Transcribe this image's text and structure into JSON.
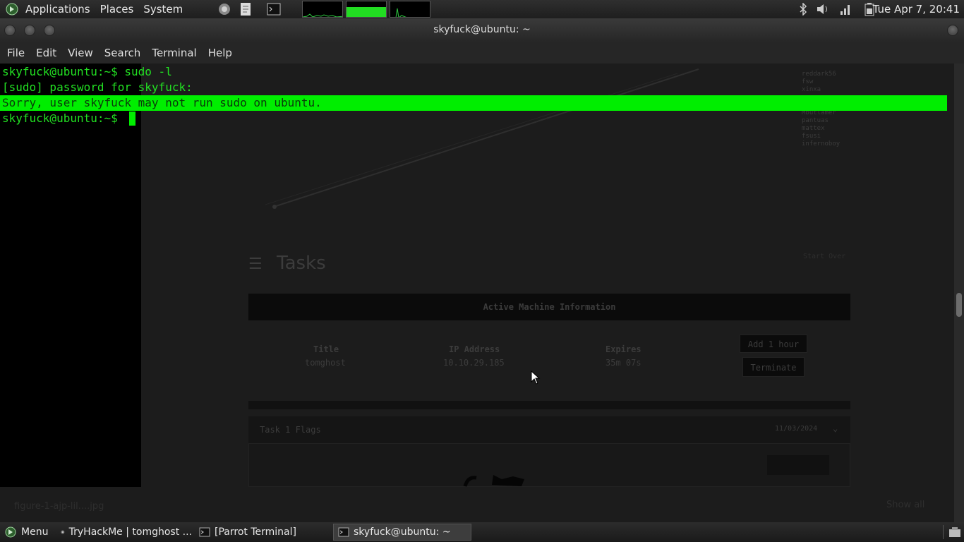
{
  "top_panel": {
    "menus": [
      "Applications",
      "Places",
      "System"
    ],
    "launchers": [
      "parrot-browser-icon",
      "text-editor-icon",
      "terminal-launcher-icon"
    ],
    "clock": "Tue Apr  7, 20:41",
    "tray_icons": [
      "bluetooth-icon",
      "volume-icon",
      "network-icon",
      "battery-icon"
    ]
  },
  "window": {
    "title": "skyfuck@ubuntu: ~",
    "menu": [
      "File",
      "Edit",
      "View",
      "Search",
      "Terminal",
      "Help"
    ]
  },
  "terminal": {
    "lines": [
      "skyfuck@ubuntu:~$ sudo -l",
      "[sudo] password for skyfuck:",
      "Sorry, user skyfuck may not run sudo on ubuntu.",
      "skyfuck@ubuntu:~$ "
    ],
    "highlight_color": "#00ee00",
    "text_color": "#22e022"
  },
  "background_page": {
    "legend": [
      "reddark56",
      "fsw",
      "xinxa",
      "Mbutlamer",
      "pantuas",
      "mattex",
      "fsusi",
      "infernoboy"
    ],
    "tasks_heading": "Tasks",
    "header_right": "Start Over",
    "machine_bar": "Active Machine Information",
    "columns": [
      "Title",
      "IP Address",
      "Expires"
    ],
    "values": [
      "tomghost",
      "10.10.29.185",
      "35m 07s"
    ],
    "buttons": [
      "Add 1 hour",
      "Terminate"
    ],
    "task_item": "Task 1  Flags",
    "task_date": "11/03/2024",
    "download": "figure-1-ajp-lil....jpg",
    "show_all": "Show all"
  },
  "taskbar": {
    "menu_label": "Menu",
    "tasks": [
      "TryHackMe | tomghost ...",
      "[Parrot Terminal]",
      "skyfuck@ubuntu: ~"
    ]
  }
}
